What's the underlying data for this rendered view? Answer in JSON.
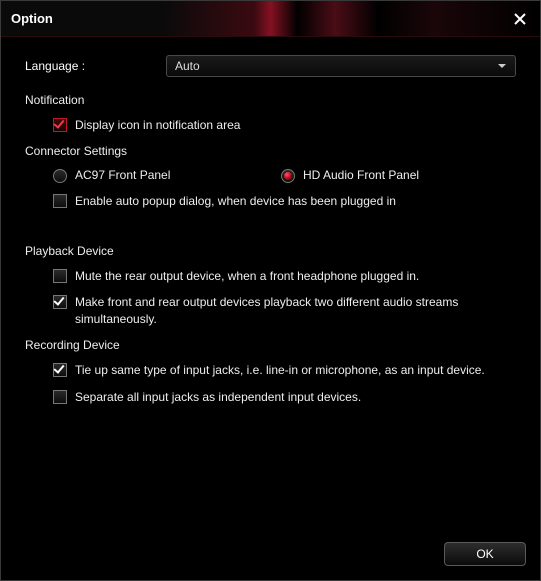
{
  "window": {
    "title": "Option"
  },
  "language": {
    "label": "Language :",
    "selected": "Auto"
  },
  "notification": {
    "heading": "Notification",
    "display_icon": {
      "label": "Display icon in notification area",
      "checked": true
    }
  },
  "connector": {
    "heading": "Connector Settings",
    "ac97": {
      "label": "AC97 Front Panel",
      "selected": false
    },
    "hd": {
      "label": "HD Audio Front Panel",
      "selected": true
    },
    "auto_popup": {
      "label": "Enable auto popup dialog, when device has been plugged in",
      "checked": false
    }
  },
  "playback": {
    "heading": "Playback Device",
    "mute_rear": {
      "label": "Mute the rear output device, when a front headphone plugged in.",
      "checked": false
    },
    "dual_stream": {
      "label": "Make front and rear output devices playback two different audio streams simultaneously.",
      "checked": true
    }
  },
  "recording": {
    "heading": "Recording Device",
    "tie_up": {
      "label": "Tie up same type of input jacks, i.e. line-in or microphone, as an input device.",
      "checked": true
    },
    "separate": {
      "label": "Separate all input jacks as independent input devices.",
      "checked": false
    }
  },
  "footer": {
    "ok": "OK"
  }
}
